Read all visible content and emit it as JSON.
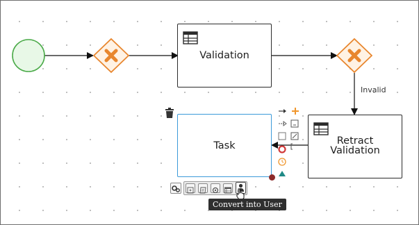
{
  "diagram": {
    "tasks": {
      "validation": {
        "label": "Validation",
        "icon": "table-icon"
      },
      "retract": {
        "label_line1": "Retract",
        "label_line2": "Validation",
        "icon": "table-icon"
      },
      "task": {
        "label": "Task",
        "selected": true
      }
    },
    "start_event": {
      "icon": "start-event-circle"
    },
    "gateways": [
      {
        "icon": "exclusive-gateway-x-icon"
      },
      {
        "icon": "exclusive-gateway-x-icon"
      }
    ],
    "edge_labels": {
      "invalid": "Invalid"
    }
  },
  "palette": {
    "items": [
      {
        "icon": "sequence-flow-arrow-icon"
      },
      {
        "icon": "add-plus-icon"
      },
      {
        "icon": "dashed-arrow-icon"
      },
      {
        "icon": "subprocess-icon"
      },
      {
        "icon": "task-square-icon"
      },
      {
        "icon": "note-icon"
      },
      {
        "icon": "annotation-icon"
      },
      {
        "icon": "end-event-icon"
      },
      {
        "icon": "timer-event-icon"
      },
      {
        "icon": "signal-triangle-icon"
      }
    ]
  },
  "toolbar": {
    "items": [
      {
        "icon": "gears-icon"
      },
      {
        "icon": "subprocess-icon"
      },
      {
        "icon": "script-icon"
      },
      {
        "icon": "service-task-icon"
      },
      {
        "icon": "business-rule-icon"
      },
      {
        "icon": "user-task-icon"
      }
    ],
    "tooltip": "Convert into User"
  },
  "colors": {
    "gateway_stroke": "#e8862e",
    "gateway_fill": "#fff2e4",
    "start_fill": "#e8f8e7",
    "start_stroke": "#4aaa48",
    "selection_stroke": "#3b9ad9",
    "resize_handle": "#8c2a2a",
    "palette_orange": "#f0962c",
    "palette_red": "#d13a3a",
    "palette_teal": "#1f8a86"
  }
}
